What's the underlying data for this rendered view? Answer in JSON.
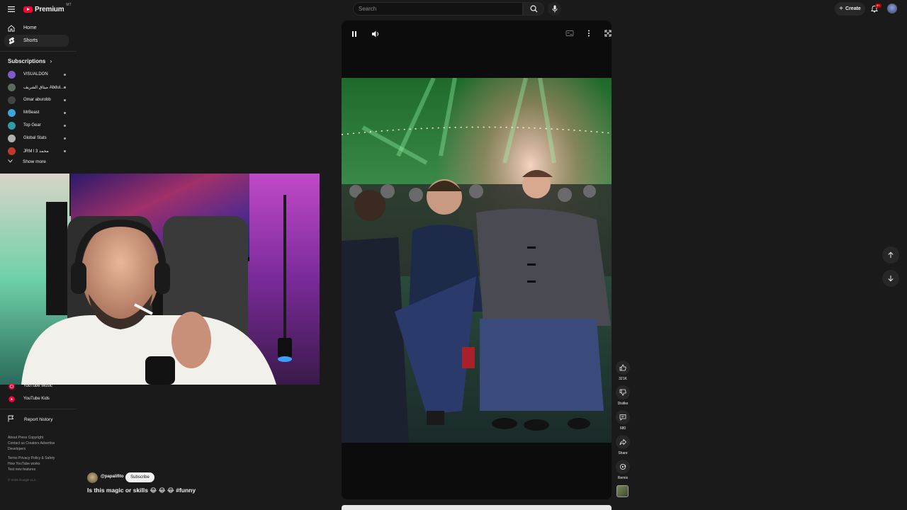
{
  "header": {
    "brand": "Premium",
    "country_code": "MT",
    "search_placeholder": "Search",
    "create_label": "Create",
    "notification_badge": "9+"
  },
  "sidebar": {
    "home_label": "Home",
    "shorts_label": "Shorts",
    "subscriptions_title": "Subscriptions",
    "subscriptions": [
      {
        "name": "VISUALDON",
        "color": "#7b5cc9"
      },
      {
        "name": "ميثاق الشريف Abdul...",
        "color": "#5d6a5d"
      },
      {
        "name": "Omar aburobb",
        "color": "#444444"
      },
      {
        "name": "MrBeast",
        "color": "#3aa7d6"
      },
      {
        "name": "Top Gear",
        "color": "#2f9ca8"
      },
      {
        "name": "Global Stats",
        "color": "#b0b0b0"
      },
      {
        "name": "JRM l محمد 3",
        "color": "#c0392b"
      }
    ],
    "show_more_label": "Show more",
    "youtube_music_label": "YouTube Music",
    "youtube_kids_label": "YouTube Kids",
    "report_history_label": "Report history",
    "footer_1": "About  Press  Copyright\nContact us  Creators  Advertise\nDevelopers",
    "footer_2": "Terms  Privacy  Policy & Safety\nHow YouTube works\nTest new features",
    "copyright": "© 2026 Google LLC"
  },
  "short": {
    "channel": "@papalifito",
    "subscribe_label": "Subscribe",
    "title": "Is this magic or skills 😂 😂 😂 #funny"
  },
  "actions": {
    "likes": "321K",
    "dislike_label": "Dislike",
    "comments": "680",
    "share_label": "Share",
    "remix_label": "Remix"
  },
  "colors": {
    "background": "#1a1a1a",
    "accent_red": "#ff0033",
    "subscribe_bg": "#f1f1f1"
  }
}
